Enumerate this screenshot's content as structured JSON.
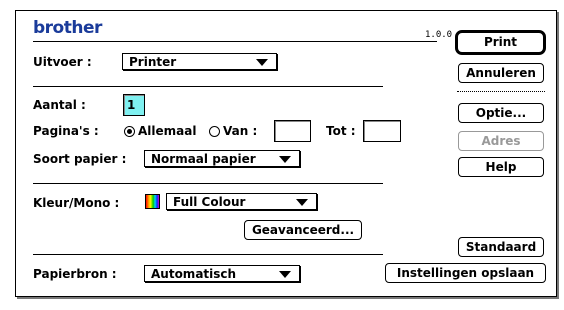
{
  "app": {
    "logo": "brother",
    "version": "1.0.0"
  },
  "output": {
    "label": "Uitvoer :",
    "value": "Printer"
  },
  "copies": {
    "label": "Aantal :",
    "value": "1"
  },
  "pages": {
    "label": "Pagina's :",
    "all_label": "Allemaal",
    "from_label": "Van :",
    "to_label": "Tot :",
    "from_value": "",
    "to_value": "",
    "selected": "all"
  },
  "paper_type": {
    "label": "Soort papier :",
    "value": "Normaal papier"
  },
  "color_mode": {
    "label": "Kleur/Mono :",
    "value": "Full Colour",
    "icon": "colour-palette-icon"
  },
  "advanced_button": "Geavanceerd...",
  "paper_source": {
    "label": "Papierbron :",
    "value": "Automatisch"
  },
  "buttons": {
    "print": "Print",
    "cancel": "Annuleren",
    "options": "Optie...",
    "address": "Adres",
    "help": "Help",
    "default": "Standaard",
    "save_settings": "Instellingen opslaan"
  },
  "colors": {
    "logo": "#1a3b9a",
    "active_field": "#7ff0f0",
    "disabled": "#999999"
  }
}
